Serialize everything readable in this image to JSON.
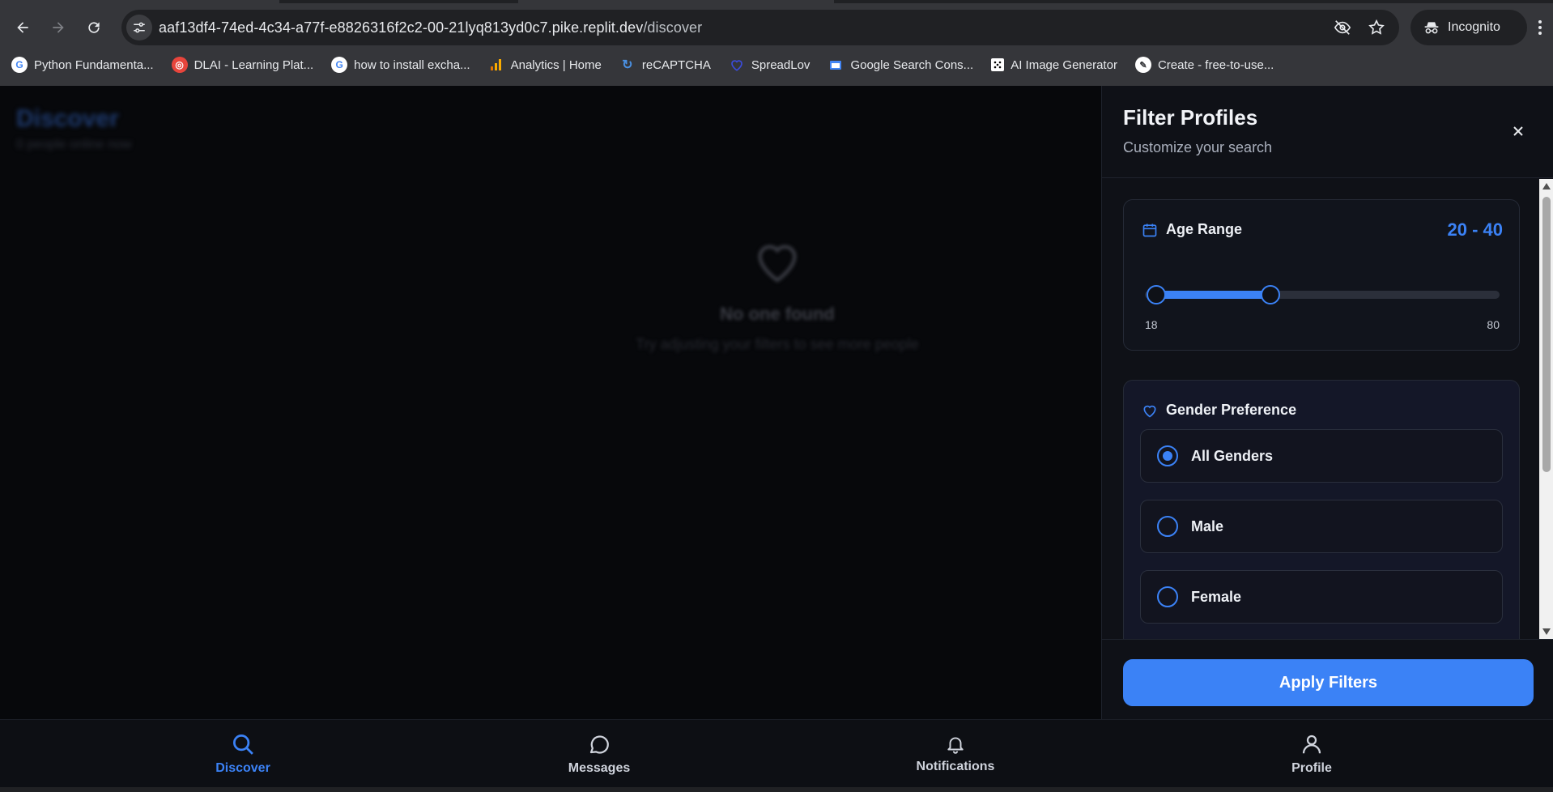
{
  "browser": {
    "url_host": "aaf13df4-74ed-4c34-a77f-e8826316f2c2-00-21lyq813yd0c7.pike.replit.dev",
    "url_path": "/discover",
    "incognito_label": "Incognito",
    "bookmarks": [
      {
        "label": "Python Fundamenta...",
        "icon": "google-g-icon",
        "color": "#ffffff"
      },
      {
        "label": "DLAI - Learning Plat...",
        "icon": "dlai-icon",
        "color": "#e8453c"
      },
      {
        "label": "how to install excha...",
        "icon": "google-g-icon",
        "color": "#ffffff"
      },
      {
        "label": "Analytics | Home",
        "icon": "analytics-icon",
        "color": "#f9ab00"
      },
      {
        "label": "reCAPTCHA",
        "icon": "recaptcha-icon",
        "color": "#4a90e2"
      },
      {
        "label": "SpreadLov",
        "icon": "heart-icon",
        "color": "#3b4cdb"
      },
      {
        "label": "Google Search Cons...",
        "icon": "search-console-icon",
        "color": "#4285f4"
      },
      {
        "label": "AI Image Generator",
        "icon": "dice-icon",
        "color": "#ffffff"
      },
      {
        "label": "Create - free-to-use...",
        "icon": "create-icon",
        "color": "#ffffff"
      }
    ]
  },
  "page": {
    "header_title": "Discover",
    "header_sub": "0 people online now",
    "empty_title": "No one found",
    "empty_sub": "Try adjusting your filters to see more people"
  },
  "filter_panel": {
    "title": "Filter Profiles",
    "subtitle": "Customize your search",
    "age": {
      "label": "Age Range",
      "value_text": "20 - 40",
      "min": 18,
      "max": 80,
      "low": 20,
      "high": 40,
      "min_label": "18",
      "max_label": "80"
    },
    "gender": {
      "label": "Gender Preference",
      "options": [
        {
          "label": "All Genders",
          "selected": true
        },
        {
          "label": "Male",
          "selected": false
        },
        {
          "label": "Female",
          "selected": false
        }
      ]
    },
    "apply_label": "Apply Filters"
  },
  "bottom_nav": {
    "items": [
      {
        "label": "Discover",
        "icon": "search-icon",
        "active": true
      },
      {
        "label": "Messages",
        "icon": "chat-bubble-icon",
        "active": false
      },
      {
        "label": "Notifications",
        "icon": "bell-icon",
        "active": false
      },
      {
        "label": "Profile",
        "icon": "user-icon",
        "active": false
      }
    ]
  },
  "colors": {
    "accent": "#3b82f6",
    "background": "#07080b",
    "panel": "#0f1117"
  }
}
